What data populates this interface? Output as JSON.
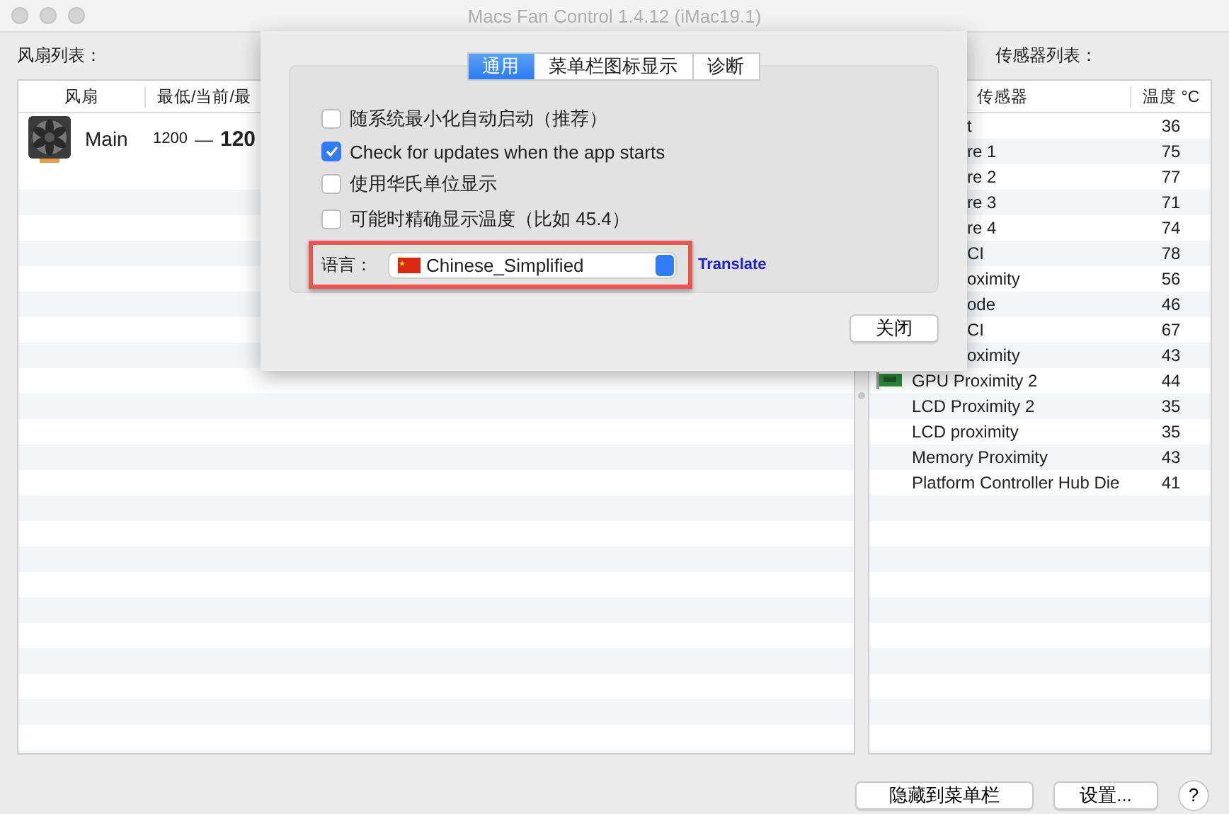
{
  "window": {
    "title": "Macs Fan Control 1.4.12 (iMac19.1)"
  },
  "fan_panel": {
    "label": "风扇列表：",
    "columns": [
      "风扇",
      "最低/当前/最"
    ],
    "rows": [
      {
        "name": "Main",
        "min": "1200",
        "dash": "—",
        "current": "120"
      }
    ]
  },
  "sensor_panel": {
    "label": "传感器列表：",
    "columns": [
      "传感器",
      "温度 °C"
    ],
    "rows": [
      {
        "name": "t",
        "value": "36",
        "kind": "covered"
      },
      {
        "name": "re 1",
        "value": "75",
        "kind": "covered"
      },
      {
        "name": "re 2",
        "value": "77",
        "kind": "covered"
      },
      {
        "name": "re 3",
        "value": "71",
        "kind": "covered"
      },
      {
        "name": "re 4",
        "value": "74",
        "kind": "covered"
      },
      {
        "name": "CI",
        "value": "78",
        "kind": "covered"
      },
      {
        "name": "oximity",
        "value": "56",
        "kind": "covered"
      },
      {
        "name": "ode",
        "value": "46",
        "kind": "covered"
      },
      {
        "name": "CI",
        "value": "67",
        "kind": "covered"
      },
      {
        "name": "oximity",
        "value": "43",
        "kind": "covered"
      },
      {
        "name": "GPU Proximity 2",
        "value": "44",
        "kind": "gpu"
      },
      {
        "name": "LCD Proximity 2",
        "value": "35",
        "kind": "plain"
      },
      {
        "name": "LCD proximity",
        "value": "35",
        "kind": "plain"
      },
      {
        "name": "Memory Proximity",
        "value": "43",
        "kind": "plain"
      },
      {
        "name": "Platform Controller Hub Die",
        "value": "41",
        "kind": "plain"
      }
    ]
  },
  "dialog": {
    "tabs": [
      {
        "label": "通用",
        "selected": true
      },
      {
        "label": "菜单栏图标显示",
        "selected": false
      },
      {
        "label": "诊断",
        "selected": false
      }
    ],
    "options": [
      {
        "label": "随系统最小化自动启动（推荐）",
        "checked": false
      },
      {
        "label": "Check for updates when the app starts",
        "checked": true
      },
      {
        "label": "使用华氏单位显示",
        "checked": false
      },
      {
        "label": "可能时精确显示温度（比如 45.4）",
        "checked": false
      }
    ],
    "language": {
      "label": "语言：",
      "value": "Chinese_Simplified",
      "link": "Translate"
    },
    "close_button": "关闭"
  },
  "buttons": [
    "隐藏到菜单栏",
    "设置...",
    "?"
  ]
}
